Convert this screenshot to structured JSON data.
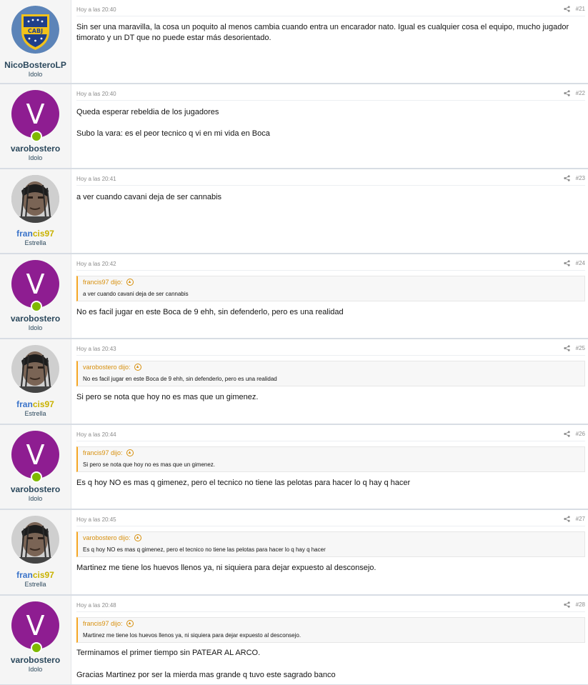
{
  "posts": [
    {
      "user": {
        "name": "NicoBosteroLP",
        "title": "Idolo",
        "avatar": "boca-crest-icon"
      },
      "time": "Hoy a las 20:40",
      "number": "#21",
      "body": [
        "Sin ser una maravilla, la cosa un poquito al menos cambia cuando entra un encarador nato. Igual es cualquier cosa el equipo, mucho jugador timorato y un DT que no puede estar más desorientado."
      ]
    },
    {
      "user": {
        "name": "varobostero",
        "title": "Idolo",
        "avatar_letter": "V"
      },
      "time": "Hoy a las 20:40",
      "number": "#22",
      "body": [
        "Queda esperar rebeldia de los jugadores",
        "Subo la vara: es el peor tecnico q vi en mi vida en Boca"
      ]
    },
    {
      "user": {
        "name_part1": "fran",
        "name_part2": "cis97",
        "title": "Estrella",
        "avatar": "user-photo"
      },
      "time": "Hoy a las 20:41",
      "number": "#23",
      "body": [
        "a ver cuando cavani deja de ser cannabis"
      ]
    },
    {
      "user": {
        "name": "varobostero",
        "title": "Idolo",
        "avatar_letter": "V"
      },
      "time": "Hoy a las 20:42",
      "number": "#24",
      "quote": {
        "author": "francis97 dijo:",
        "text": "a ver cuando cavani deja de ser cannabis"
      },
      "body": [
        "No es facil jugar en este Boca de 9 ehh, sin defenderlo, pero es una realidad"
      ]
    },
    {
      "user": {
        "name_part1": "fran",
        "name_part2": "cis97",
        "title": "Estrella",
        "avatar": "user-photo"
      },
      "time": "Hoy a las 20:43",
      "number": "#25",
      "quote": {
        "author": "varobostero dijo:",
        "text": "No es facil jugar en este Boca de 9 ehh, sin defenderlo, pero es una realidad"
      },
      "body": [
        "Si pero se nota que hoy no es mas que un gimenez."
      ]
    },
    {
      "user": {
        "name": "varobostero",
        "title": "Idolo",
        "avatar_letter": "V"
      },
      "time": "Hoy a las 20:44",
      "number": "#26",
      "quote": {
        "author": "francis97 dijo:",
        "text": "Si pero se nota que hoy no es mas que un gimenez."
      },
      "body": [
        "Es q hoy NO es mas q gimenez, pero el tecnico no tiene las pelotas para hacer lo q hay q hacer"
      ]
    },
    {
      "user": {
        "name_part1": "fran",
        "name_part2": "cis97",
        "title": "Estrella",
        "avatar": "user-photo"
      },
      "time": "Hoy a las 20:45",
      "number": "#27",
      "quote": {
        "author": "varobostero dijo:",
        "text": "Es q hoy NO es mas q gimenez, pero el tecnico no tiene las pelotas para hacer lo q hay q hacer"
      },
      "body": [
        "Martinez me tiene los huevos llenos ya, ni siquiera para dejar expuesto al desconsejo."
      ]
    },
    {
      "user": {
        "name": "varobostero",
        "title": "Idolo",
        "avatar_letter": "V"
      },
      "time": "Hoy a las 20:48",
      "number": "#28",
      "quote": {
        "author": "francis97 dijo:",
        "text": "Martinez me tiene los huevos llenos ya, ni siquiera para dejar expuesto al desconsejo."
      },
      "body": [
        "Terminamos el primer tiempo sin PATEAR AL ARCO.",
        "Gracias Martinez por ser la mierda mas grande q tuvo este sagrado banco"
      ]
    }
  ],
  "colors": {
    "accent_quote": "#f5a623",
    "avatar_v": "#8e1d91",
    "online": "#7fb900",
    "username": "#2b485c"
  }
}
